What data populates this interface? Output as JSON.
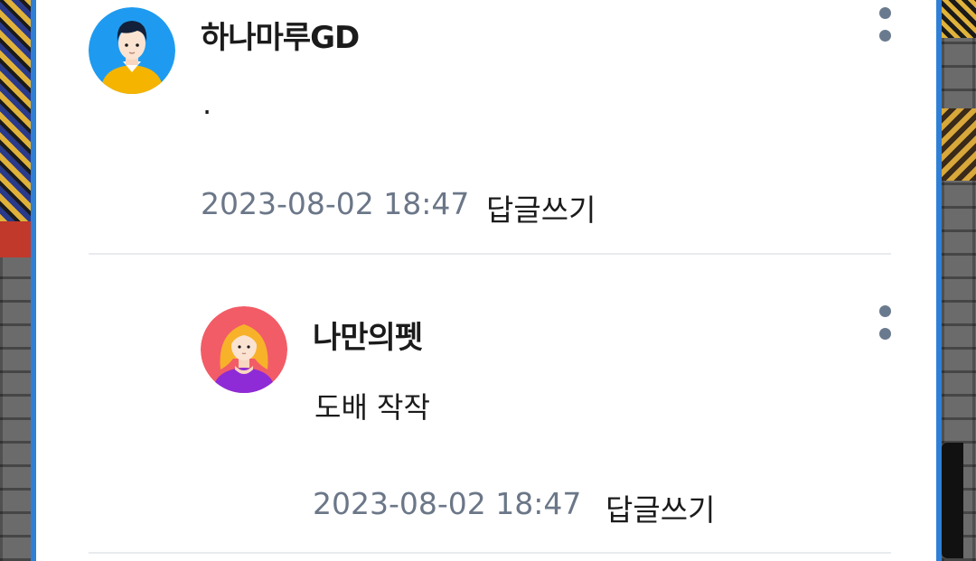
{
  "comments": [
    {
      "author": "하나마루GD",
      "text": ".",
      "date": "2023-08-02 18:47",
      "reply_label": "답글쓰기",
      "avatar": "male-avatar-icon",
      "colors": {
        "avatar_bg": "#1e9bf0",
        "shirt": "#f5b400"
      }
    }
  ],
  "replies": [
    {
      "author": "나만의펫",
      "text": "도배 작작",
      "date": "2023-08-02 18:47",
      "reply_label": "답글쓰기",
      "avatar": "female-avatar-icon",
      "colors": {
        "avatar_bg": "#f25c66",
        "shirt": "#8e2bd6"
      }
    }
  ],
  "more_menu_icon": "more-vertical-icon",
  "colors": {
    "accent": "#2f7fd6",
    "date_text": "#6b7788",
    "divider": "#e9ebee"
  }
}
